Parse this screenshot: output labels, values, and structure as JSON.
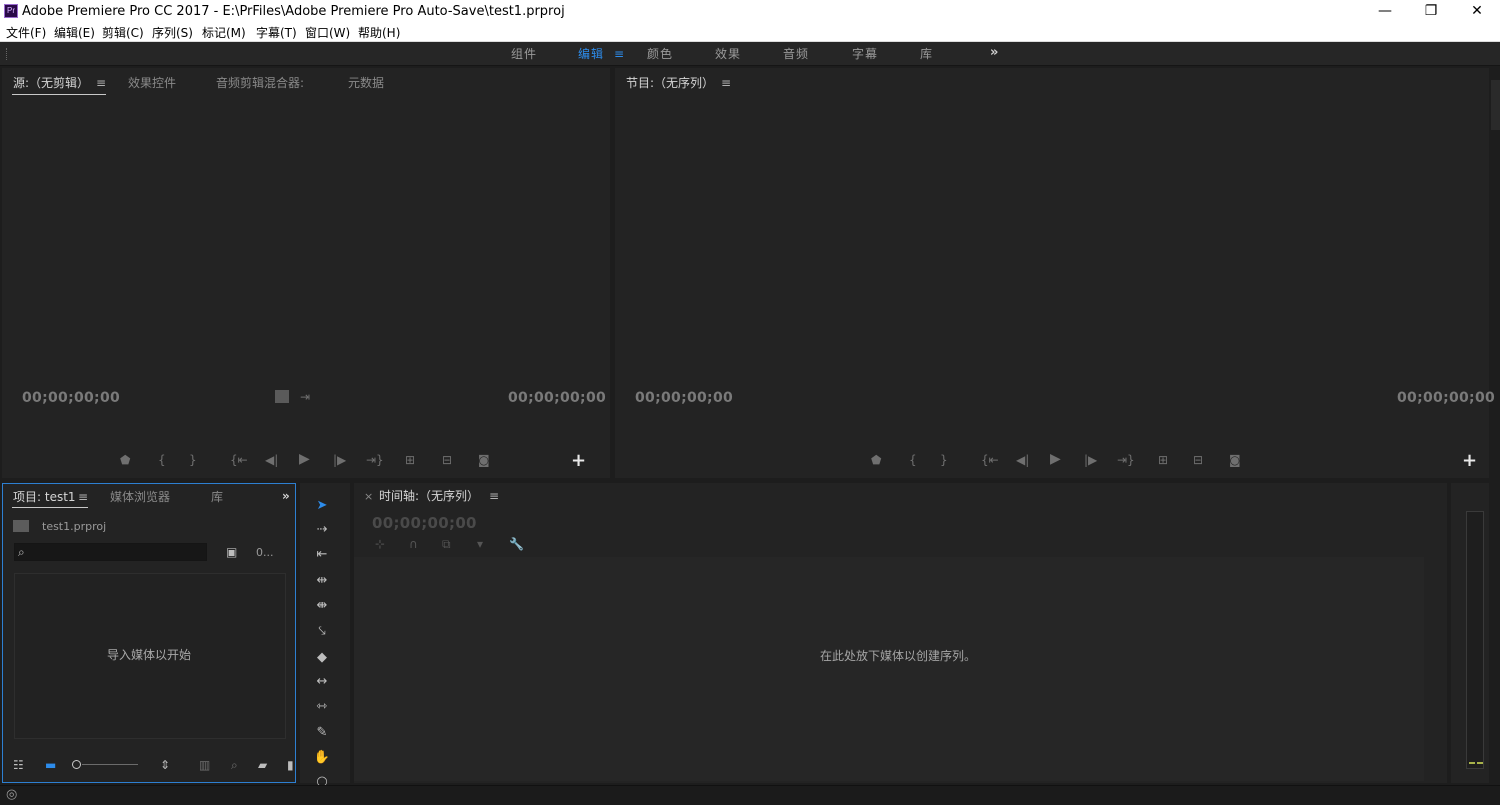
{
  "window": {
    "title": "Adobe Premiere Pro CC 2017 - E:\\PrFiles\\Adobe Premiere Pro Auto-Save\\test1.prproj",
    "app_icon_text": "Pr",
    "minimize": "—",
    "restore": "❐",
    "close": "✕"
  },
  "menu": [
    "文件(F)",
    "编辑(E)",
    "剪辑(C)",
    "序列(S)",
    "标记(M)",
    "字幕(T)",
    "窗口(W)",
    "帮助(H)"
  ],
  "workspaces": {
    "tabs": [
      "组件",
      "编辑",
      "颜色",
      "效果",
      "音频",
      "字幕",
      "库"
    ],
    "active": "编辑",
    "menu_icon": "≡",
    "more": "»"
  },
  "source_panel": {
    "tabs": [
      "源:（无剪辑）",
      "效果控件",
      "音频剪辑混合器:",
      "元数据"
    ],
    "menu_icon": "≡",
    "timecode_left": "00;00;00;00",
    "timecode_right": "00;00;00;00",
    "add_button": "+"
  },
  "program_panel": {
    "tab": "节目:（无序列）",
    "menu_icon": "≡",
    "timecode_left": "00;00;00;00",
    "timecode_right": "00;00;00;00",
    "add_button": "+"
  },
  "project_panel": {
    "tabs": [
      "项目: test1",
      "媒体浏览器",
      "库"
    ],
    "menu_icon": "≡",
    "more": "»",
    "file_name": "test1.prproj",
    "items_count": "0...",
    "empty_message": "导入媒体以开始"
  },
  "timeline_panel": {
    "close": "×",
    "tab": "时间轴:（无序列）",
    "menu_icon": "≡",
    "timecode": "00;00;00;00",
    "empty_message": "在此处放下媒体以创建序列。"
  },
  "colors": {
    "accent": "#2d8ceb",
    "panel_bg": "#232323",
    "app_bg": "#1d1d1d"
  }
}
